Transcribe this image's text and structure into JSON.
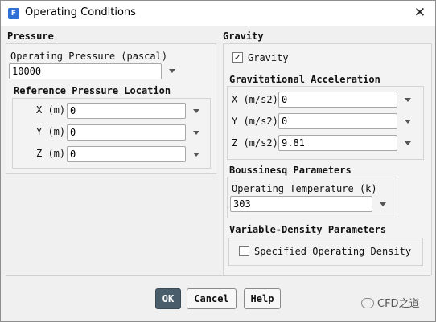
{
  "window": {
    "title": "Operating Conditions",
    "app_icon_letter": "F",
    "close_glyph": "✕"
  },
  "pressure": {
    "title": "Pressure",
    "operating_label": "Operating Pressure (pascal)",
    "operating_value": "10000",
    "ref_title": "Reference Pressure Location",
    "x_label": "X (m)",
    "x_value": "0",
    "y_label": "Y (m)",
    "y_value": "0",
    "z_label": "Z (m)",
    "z_value": "0"
  },
  "gravity": {
    "title": "Gravity",
    "checkbox_label": "Gravity",
    "checked": true,
    "check_glyph": "✓",
    "accel_title": "Gravitational Acceleration",
    "x_label": "X (m/s2)",
    "x_value": "0",
    "y_label": "Y (m/s2)",
    "y_value": "0",
    "z_label": "Z (m/s2)",
    "z_value": "9.81"
  },
  "boussinesq": {
    "title": "Boussinesq Parameters",
    "temp_label": "Operating Temperature (k)",
    "temp_value": "303"
  },
  "variable_density": {
    "title": "Variable-Density Parameters",
    "checkbox_label": "Specified Operating Density",
    "checked": false
  },
  "buttons": {
    "ok": "OK",
    "cancel": "Cancel",
    "help": "Help"
  },
  "watermark": "CFD之道"
}
